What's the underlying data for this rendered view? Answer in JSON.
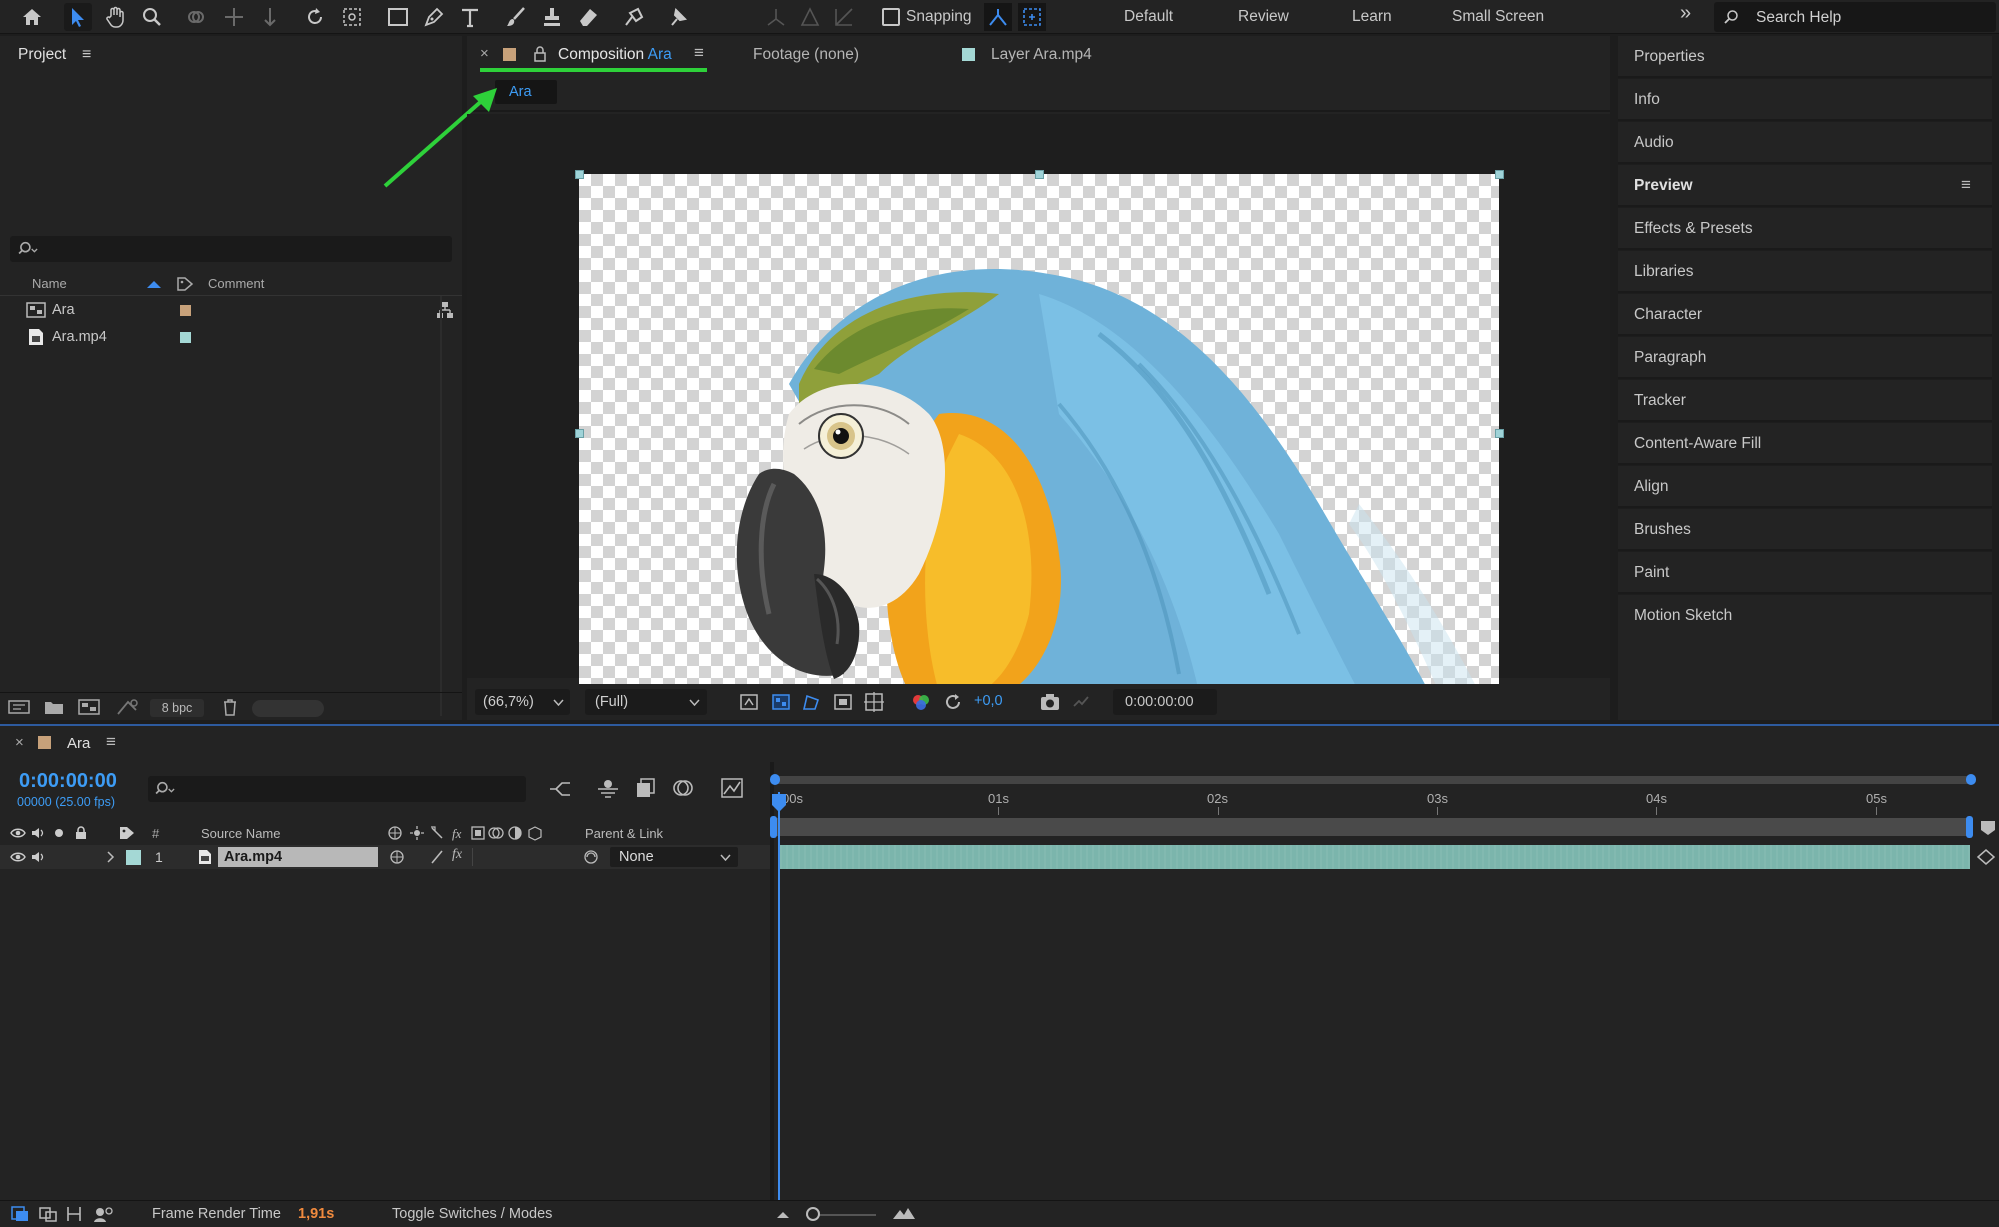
{
  "toolbar": {
    "snapping_label": "Snapping",
    "workspaces": [
      "Default",
      "Review",
      "Learn",
      "Small Screen"
    ],
    "more_icon": "»",
    "search_placeholder": "Search Help"
  },
  "project": {
    "title": "Project",
    "columns": {
      "name": "Name",
      "comment": "Comment"
    },
    "items": [
      {
        "name": "Ara",
        "type": "composition",
        "label_color": "#c7a17a"
      },
      {
        "name": "Ara.mp4",
        "type": "footage",
        "label_color": "#a4d8d5"
      }
    ],
    "bpc": "8 bpc"
  },
  "viewer": {
    "tab_composition_prefix": "Composition",
    "tab_composition_name": "Ara",
    "tab_footage": "Footage (none)",
    "tab_layer": "Layer Ara.mp4",
    "breadcrumb": "Ara",
    "zoom": "(66,7%)",
    "resolution": "(Full)",
    "exposure": "+0,0",
    "timecode": "0:00:00:00",
    "accent_color": "#2ed13a"
  },
  "right_panel": {
    "items": [
      "Properties",
      "Info",
      "Audio",
      "Preview",
      "Effects & Presets",
      "Libraries",
      "Character",
      "Paragraph",
      "Tracker",
      "Content-Aware Fill",
      "Align",
      "Brushes",
      "Paint",
      "Motion Sketch"
    ],
    "active": "Preview"
  },
  "timeline": {
    "comp_name": "Ara",
    "timecode": "0:00:00:00",
    "frame_info": "00000 (25.00 fps)",
    "columns": {
      "num": "#",
      "source_name": "Source Name",
      "parent": "Parent & Link"
    },
    "ruler": [
      "00s",
      "01s",
      "02s",
      "03s",
      "04s",
      "05s"
    ],
    "layers": [
      {
        "index": "1",
        "name": "Ara.mp4",
        "parent": "None",
        "label_color": "#a4d8d5"
      }
    ],
    "bar_color": "#7bb5ac"
  },
  "status": {
    "frame_render_label": "Frame Render Time",
    "frame_render_value": "1,91s",
    "toggle_label": "Toggle Switches / Modes"
  }
}
